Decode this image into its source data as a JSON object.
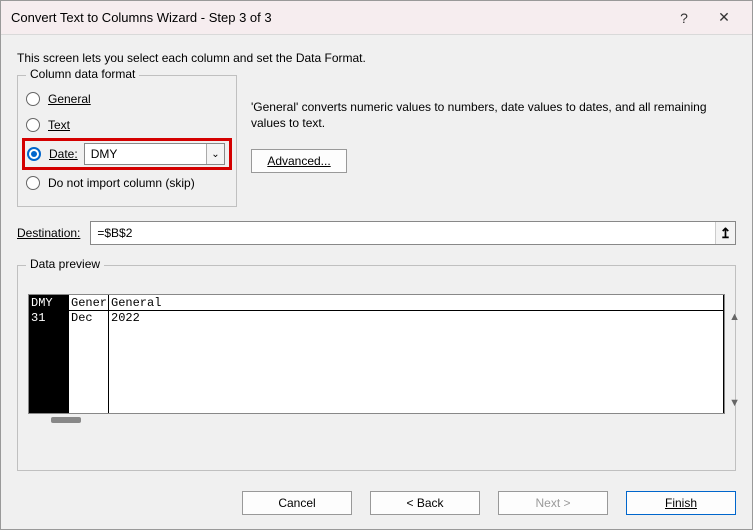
{
  "titlebar": {
    "title": "Convert Text to Columns Wizard - Step 3 of 3"
  },
  "instruction": "This screen lets you select each column and set the Data Format.",
  "format_group": {
    "legend": "Column data format",
    "general": "General",
    "text": "Text",
    "date": "Date:",
    "date_format": "DMY",
    "skip": "Do not import column (skip)"
  },
  "side_note": "'General' converts numeric values to numbers, date values to dates, and all remaining values to text.",
  "advanced_button": "Advanced...",
  "destination": {
    "label": "Destination:",
    "value": "=$B$2"
  },
  "preview": {
    "legend": "Data preview",
    "headers": [
      "DMY",
      "Gener",
      "General"
    ],
    "row": [
      "31",
      "Dec",
      "2022"
    ]
  },
  "buttons": {
    "cancel": "Cancel",
    "back": "< Back",
    "next": "Next >",
    "finish": "Finish"
  }
}
